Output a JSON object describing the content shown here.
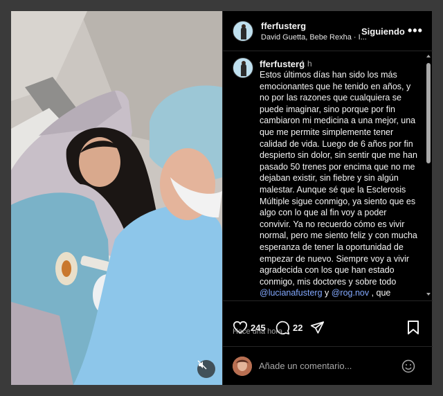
{
  "post": {
    "username": "fferfusterg",
    "music": "David Guetta, Bebe Rexha · I...",
    "follow_label": "Siguiendo",
    "more_label": "•••"
  },
  "caption": {
    "username": "fferfusterg",
    "time": "1 h",
    "text_main": "Estos últimos días han sido los más emocionantes que he tenido en años, y no por las razones que cualquiera se puede imaginar, sino porque por fin cambiaron mi medicina a una mejor, una que me permite simplemente tener calidad de vida. Luego de 6 años por fin despierto sin dolor, sin sentir que me han pasado 50 trenes por encima que no me dejaban existir, sin fiebre y sin algún malestar. Aunque sé que la Esclerosis Múltiple sigue conmigo, ya siento que es algo con lo que al fin voy a poder convivir. Ya no recuerdo cómo es vivir normal, pero me siento feliz y con mucha esperanza de tener la oportunidad de empezar de nuevo. Siempre voy a vivir agradecida con los que han estado conmigo, mis doctores y sobre todo ",
    "mention1": "@lucianafusterg",
    "text_and": " y ",
    "mention2": "@rog.nov",
    "text_tail": " , que siempre han sido mi"
  },
  "actions": {
    "likes": "245",
    "comments": "22",
    "time_ago": "Hace una hora"
  },
  "comment_box": {
    "placeholder": "Añade un comentario..."
  },
  "colors": {
    "background": "#000000",
    "mention": "#83a9ff",
    "muted_text": "#a8a8a8"
  },
  "icons": [
    "heart-icon",
    "comment-icon",
    "share-icon",
    "bookmark-icon",
    "emoji-icon",
    "muted-speaker-icon",
    "more-icon"
  ]
}
